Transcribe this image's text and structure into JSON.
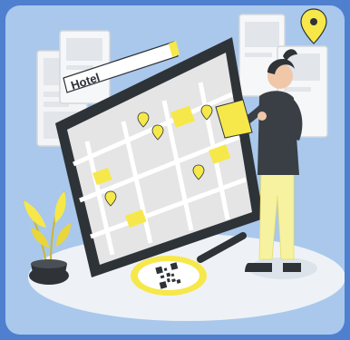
{
  "illustration": {
    "search_label": "Hotel",
    "colors": {
      "background": "#a9c8ec",
      "frame": "#4f7fcf",
      "accent_yellow": "#f6e84a",
      "tablet_dark": "#2e3338",
      "map_light": "#e8e8e8",
      "shadow_ellipse": "#e9eef4"
    },
    "icons": [
      "map-pin-icon",
      "magnifying-glass-icon",
      "qr-code-icon",
      "plant-icon",
      "tablet-icon"
    ]
  }
}
